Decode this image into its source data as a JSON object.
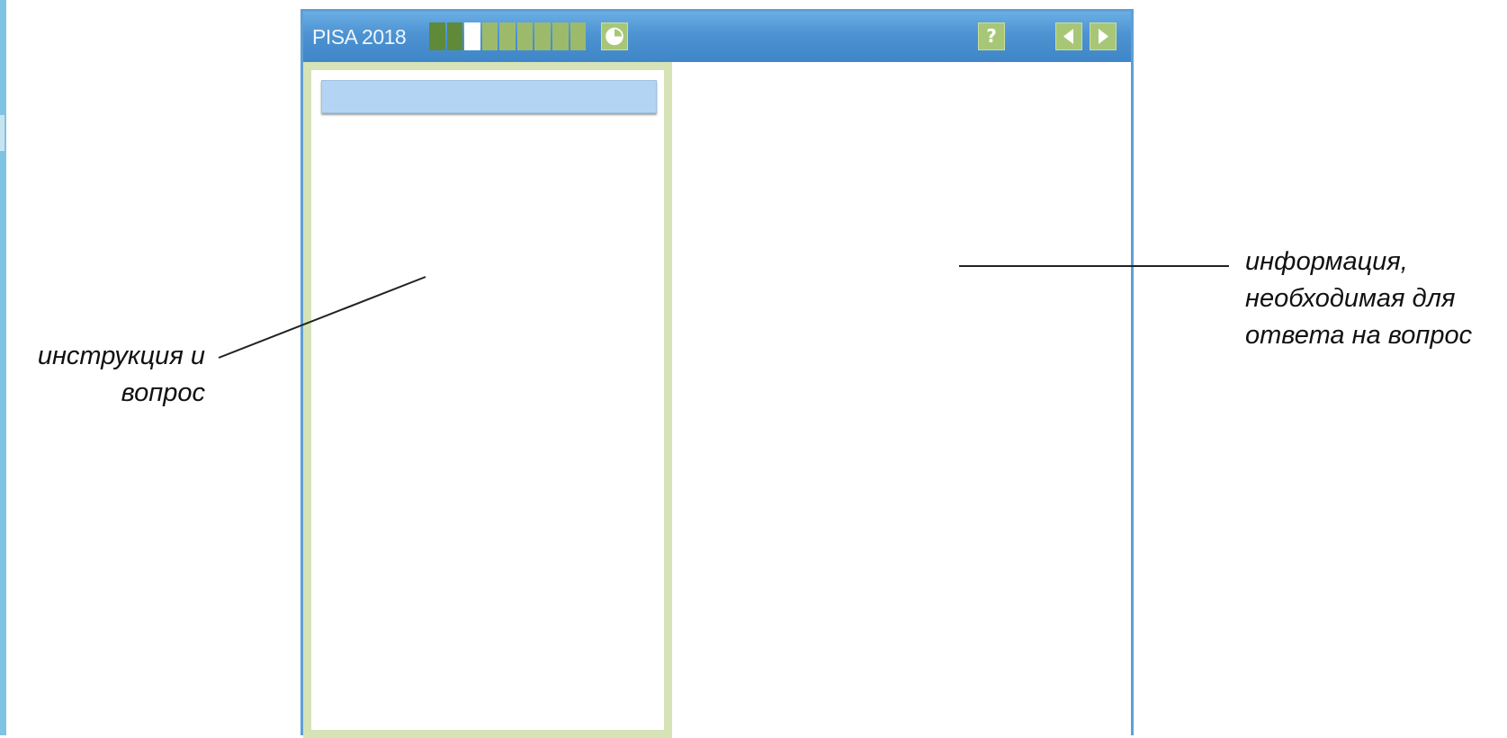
{
  "window": {
    "title": "PISA 2018",
    "progress": {
      "total_segments": 9,
      "completed_segments": 2,
      "current_segment": 3
    },
    "toolbar": {
      "timer_icon": "timer-icon",
      "help_icon": "help-icon",
      "help_glyph": "?",
      "prev_icon": "arrow-left-icon",
      "next_icon": "arrow-right-icon"
    }
  },
  "callouts": {
    "left": {
      "line1": "инструкция и",
      "line2": "вопрос"
    },
    "right": {
      "line1": "информация,",
      "line2": "необходимая для",
      "line3": "ответа на вопрос"
    }
  },
  "colors": {
    "titlebar": "#4d93d2",
    "progress_done": "#5e8a39",
    "progress_todo": "#9dba6b",
    "pane_border": "#d5e3b6",
    "question_bar": "#b3d5f3"
  }
}
